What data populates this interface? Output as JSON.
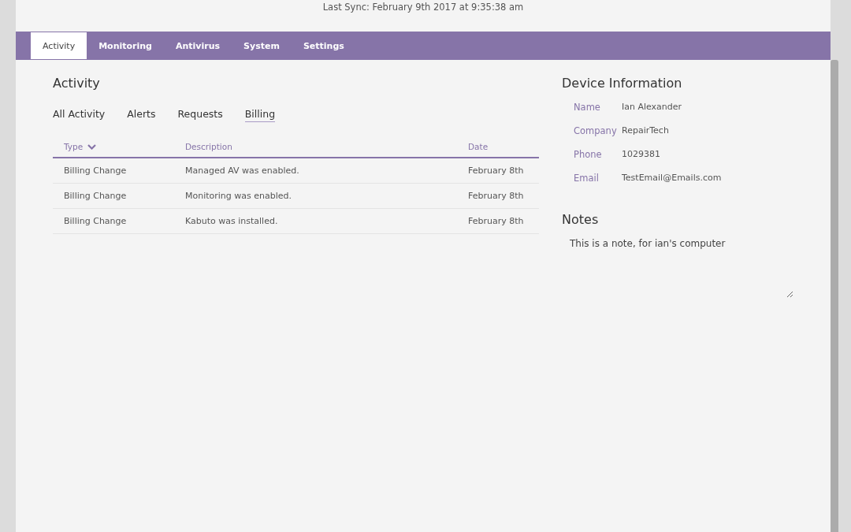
{
  "sync": "Last Sync: February 9th 2017 at 9:35:38 am",
  "tabs": [
    {
      "label": "Activity",
      "selected": true
    },
    {
      "label": "Monitoring",
      "selected": false
    },
    {
      "label": "Antivirus",
      "selected": false
    },
    {
      "label": "System",
      "selected": false
    },
    {
      "label": "Settings",
      "selected": false
    }
  ],
  "activity": {
    "title": "Activity",
    "filters": [
      {
        "label": "All Activity",
        "selected": false
      },
      {
        "label": "Alerts",
        "selected": false
      },
      {
        "label": "Requests",
        "selected": false
      },
      {
        "label": "Billing",
        "selected": true
      }
    ],
    "columns": [
      {
        "label": "Type",
        "sorted": true
      },
      {
        "label": "Description",
        "sorted": false
      },
      {
        "label": "Date",
        "sorted": false
      }
    ],
    "rows": [
      [
        "Billing Change",
        "Managed AV was enabled.",
        "February 8th"
      ],
      [
        "Billing Change",
        "Monitoring was enabled.",
        "February 8th"
      ],
      [
        "Billing Change",
        "Kabuto was installed.",
        "February 8th"
      ]
    ]
  },
  "device": {
    "title": "Device Information",
    "fields": [
      {
        "label": "Name",
        "value": "Ian Alexander"
      },
      {
        "label": "Company",
        "value": "RepairTech"
      },
      {
        "label": "Phone",
        "value": "1029381"
      },
      {
        "label": "Email",
        "value": "TestEmail@Emails.com"
      }
    ]
  },
  "notes": {
    "title": "Notes",
    "value": "This is a note, for ian's computer"
  }
}
